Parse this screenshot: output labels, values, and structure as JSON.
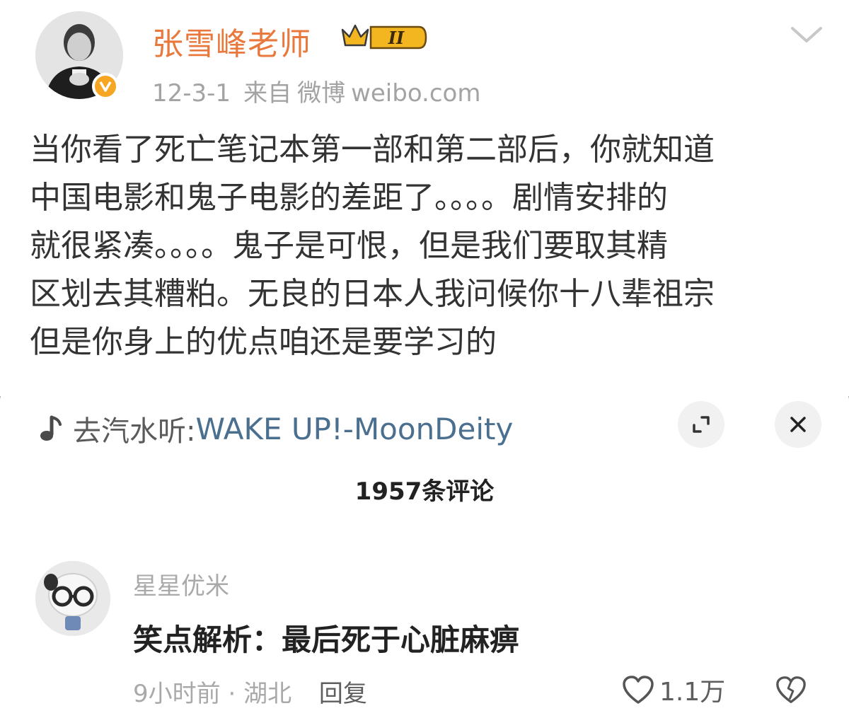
{
  "post": {
    "username": "张雪峰老师",
    "badge_icon": "crown-level-badge-icon",
    "badge_text": "II",
    "date": "12-3-1",
    "source_prefix": "来自",
    "source_app": "微博",
    "source_site": "weibo.com",
    "body_lines": [
      "当你看了死亡笔记本第一部和第二部后，你就知道",
      "中国电影和鬼子电影的差距了。。。。剧情安排的",
      "就很紧凑。。。。鬼子是可恨，但是我们要取其精",
      "区划去其糟粕。无良的日本人我问候你十八辈祖宗",
      "但是你身上的优点咱还是要学习的"
    ]
  },
  "sheet": {
    "music_prefix": "去汽水听:",
    "music_title": "WAKE UP!-MoonDeity",
    "comments_count": "1957条评论"
  },
  "comment": {
    "username": "星星优米",
    "text": "笑点解析：最后死于心脏麻痹",
    "time": "9小时前",
    "separator": "·",
    "location": "湖北",
    "reply_label": "回复",
    "like_count": "1.1万"
  },
  "colors": {
    "username_orange": "#e8783c",
    "badge_gold": "#f3b620",
    "music_title_blue": "#4a6f8f",
    "gray_text": "#a9a9a9"
  }
}
